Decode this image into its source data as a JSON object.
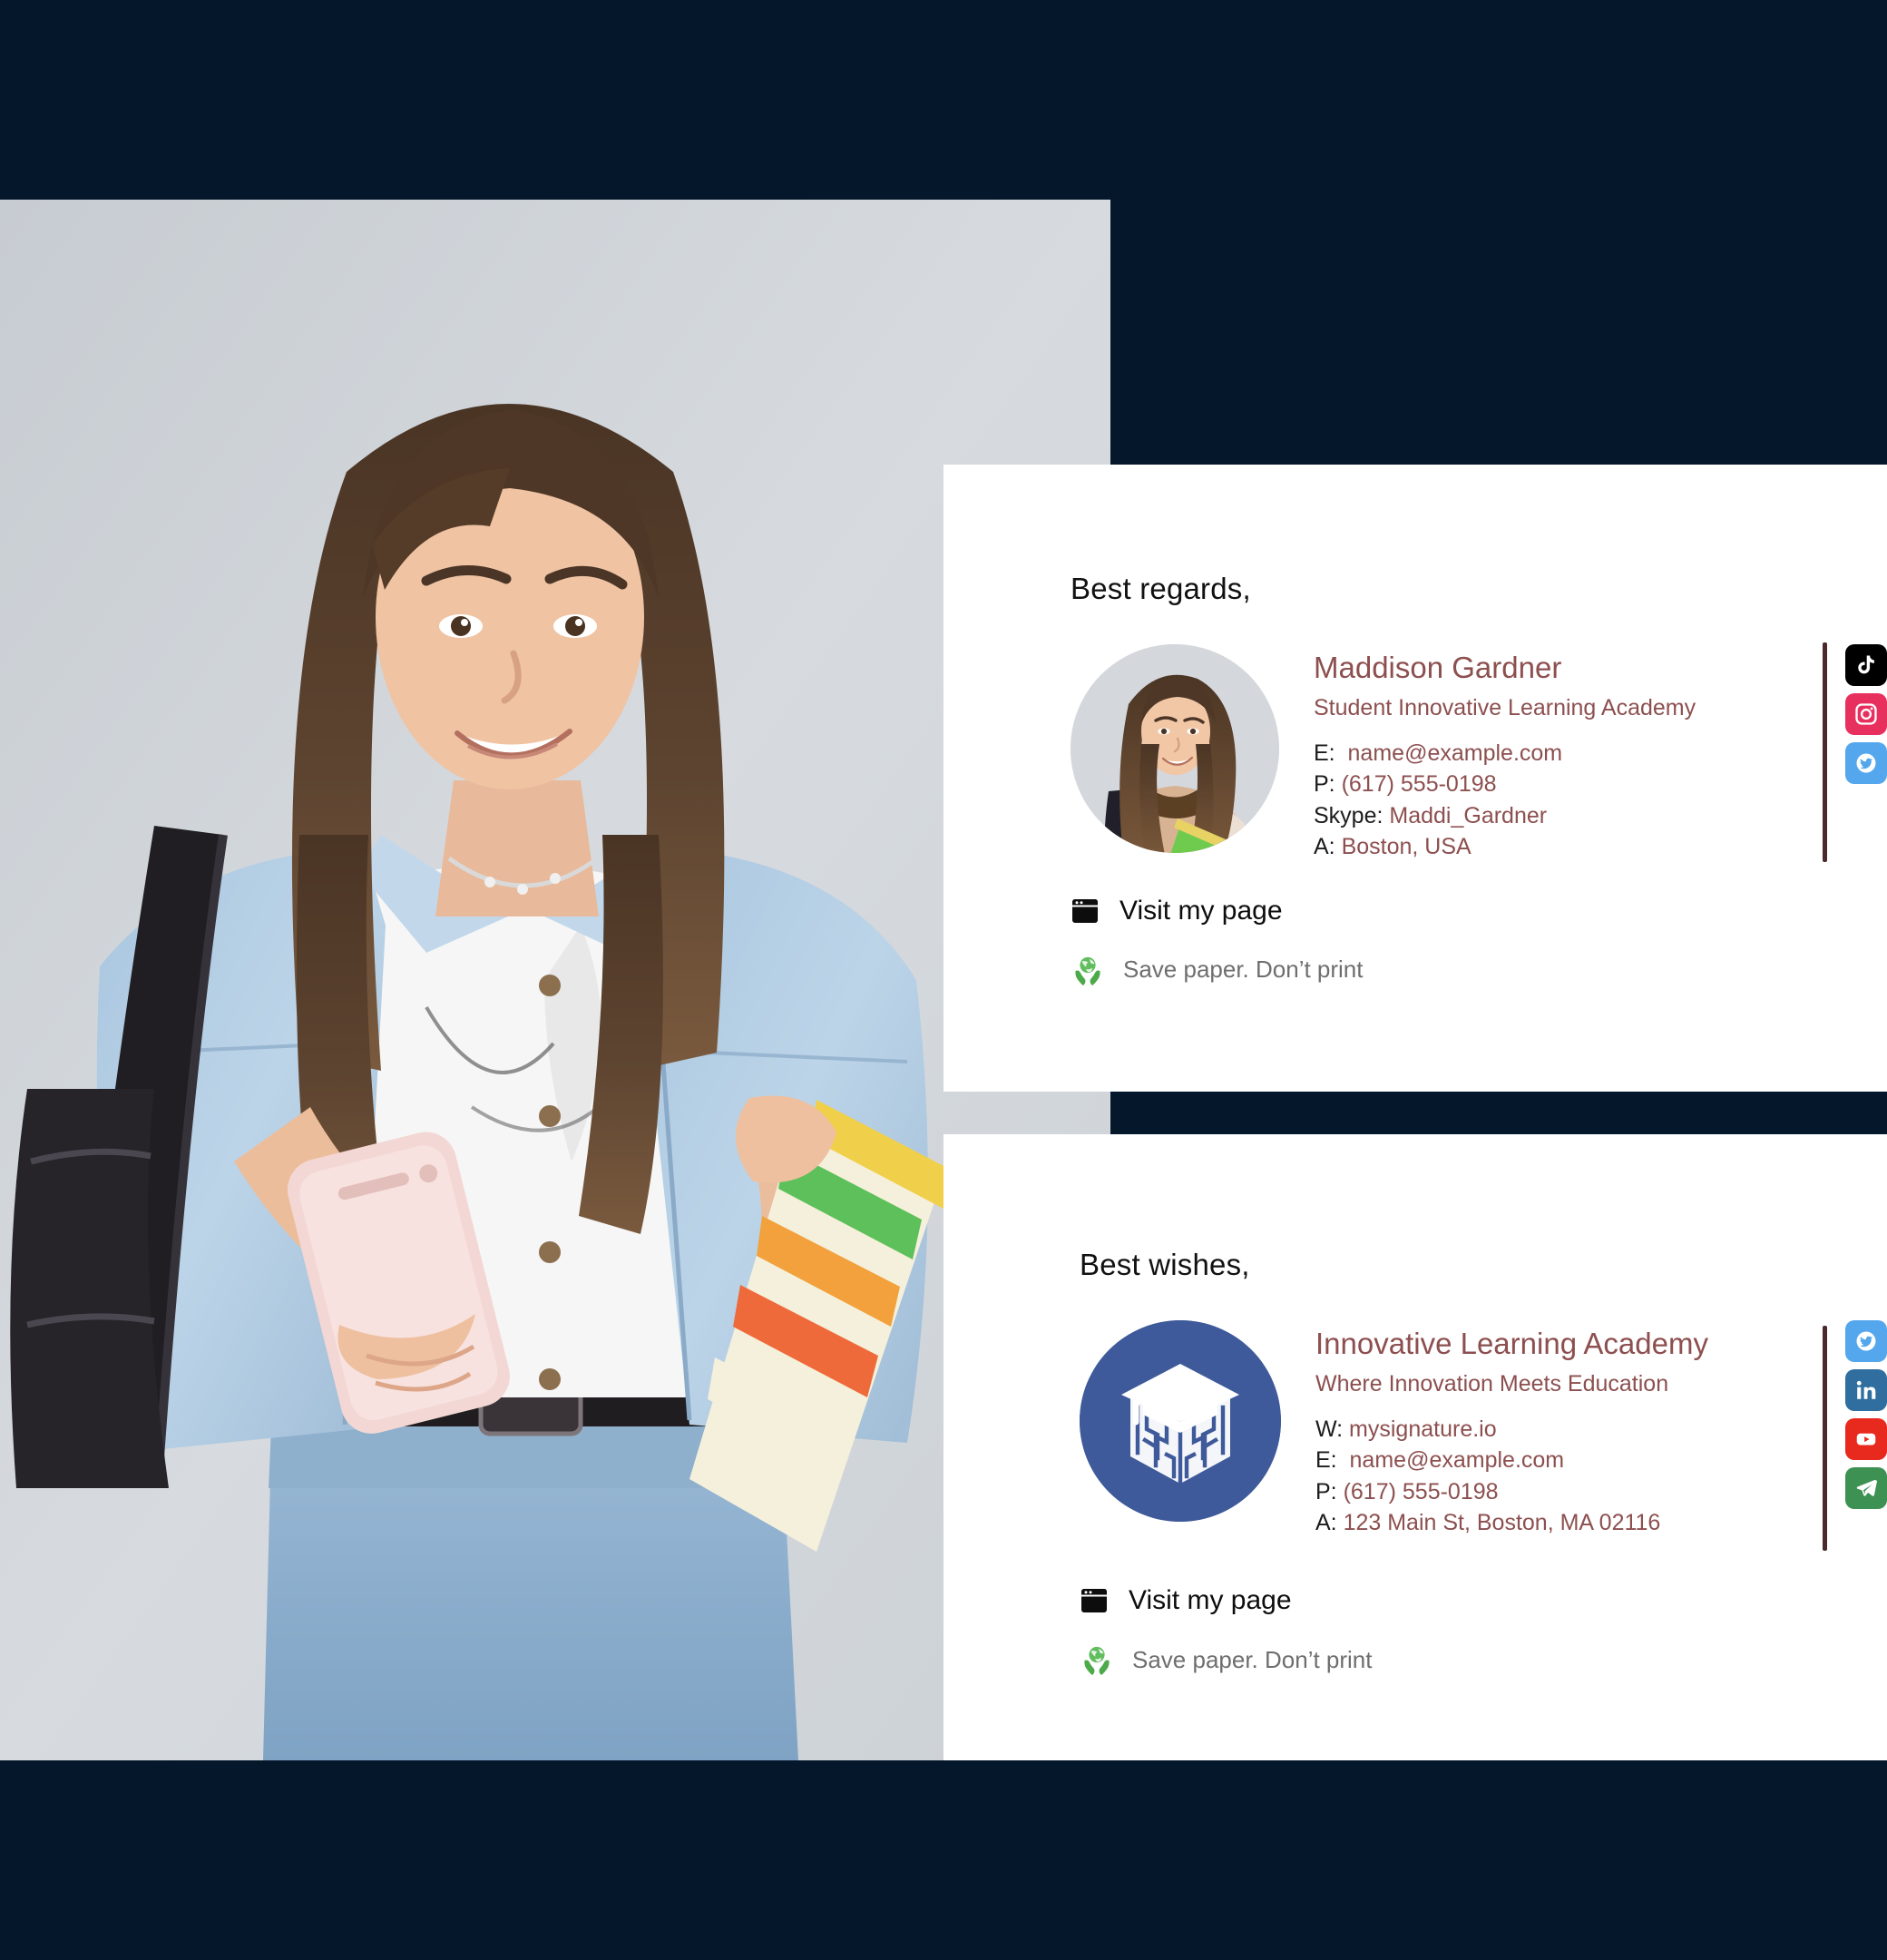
{
  "page": {
    "background_color": "#05172b"
  },
  "hero_photo": {
    "alt": "Smiling student with backpack holding smartphone and notebooks",
    "background_color": "#d0d5da"
  },
  "signatures": [
    {
      "id": "student-signature",
      "salutation": "Best regards,",
      "avatar": {
        "type": "photo-avatar",
        "alt": "Portrait of Maddison Gardner",
        "background_color": "#d6dade"
      },
      "name": "Maddison Gardner",
      "title": "Student Innovative Learning Academy",
      "accent_color": "#8d4f4f",
      "contact": [
        {
          "label": "E:",
          "value": "name@example.com"
        },
        {
          "label": "P:",
          "value": "(617) 555-0198"
        },
        {
          "label": "Skype:",
          "value": "Maddi_Gardner"
        },
        {
          "label": "A:",
          "value": "Boston, USA"
        }
      ],
      "divider_color": "#4a2a2a",
      "social": [
        {
          "name": "tiktok-icon",
          "label": "TikTok",
          "color": "#000000"
        },
        {
          "name": "instagram-icon",
          "label": "Instagram",
          "color": "#e8305f"
        },
        {
          "name": "twitter-icon",
          "label": "Twitter",
          "color": "#54a7ec"
        }
      ],
      "visit_link": "Visit my page",
      "eco_note": "Save paper. Don’t print"
    },
    {
      "id": "company-signature",
      "salutation": "Best wishes,",
      "logo": {
        "type": "brand-logo",
        "alt": "Innovative Learning Academy graduation cap cube logo",
        "background_color": "#3f5a9a",
        "mark_color": "#ffffff"
      },
      "name": "Innovative Learning Academy",
      "title": "Where Innovation Meets Education",
      "accent_color": "#8d4f4f",
      "contact": [
        {
          "label": "W:",
          "value": "mysignature.io"
        },
        {
          "label": "E:",
          "value": "name@example.com"
        },
        {
          "label": "P:",
          "value": "(617) 555-0198"
        },
        {
          "label": "A:",
          "value": "123 Main St, Boston, MA 02116"
        }
      ],
      "divider_color": "#4a2a2a",
      "social": [
        {
          "name": "twitter-icon",
          "label": "Twitter",
          "color": "#54a7ec"
        },
        {
          "name": "linkedin-icon",
          "label": "LinkedIn",
          "color": "#2f6e9e"
        },
        {
          "name": "youtube-icon",
          "label": "YouTube",
          "color": "#e8291d"
        },
        {
          "name": "telegram-icon",
          "label": "Telegram",
          "color": "#3d9153"
        }
      ],
      "visit_link": "Visit my page",
      "eco_note": "Save paper. Don’t print"
    }
  ]
}
